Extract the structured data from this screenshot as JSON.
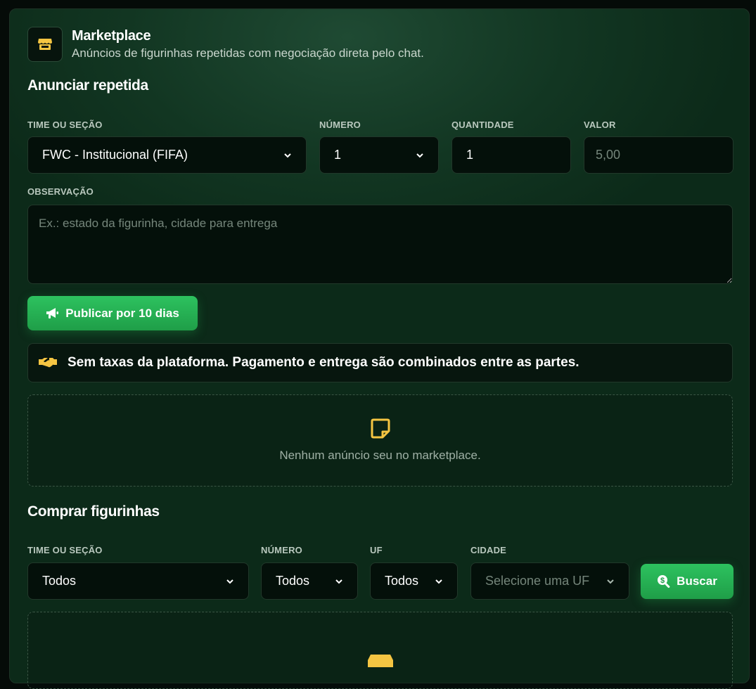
{
  "header": {
    "title": "Marketplace",
    "subtitle": "Anúncios de figurinhas repetidas com negociação direta pelo chat.",
    "icon": "store-icon"
  },
  "announce": {
    "section_title": "Anunciar repetida",
    "team_label": "TIME OU SEÇÃO",
    "team_value": "FWC - Institucional (FIFA)",
    "number_label": "NÚMERO",
    "number_value": "1",
    "quantity_label": "QUANTIDADE",
    "quantity_value": "1",
    "price_label": "VALOR",
    "price_placeholder": "5,00",
    "note_label": "OBSERVAÇÃO",
    "note_placeholder": "Ex.: estado da figurinha, cidade para entrega",
    "publish_label": "Publicar por 10 dias",
    "info_text": "Sem taxas da plataforma. Pagamento e entrega são combinados entre as partes.",
    "empty_text": "Nenhum anúncio seu no marketplace."
  },
  "buy": {
    "section_title": "Comprar figurinhas",
    "team_label": "TIME OU SEÇÃO",
    "team_value": "Todos",
    "number_label": "NÚMERO",
    "number_value": "Todos",
    "uf_label": "UF",
    "uf_value": "Todos",
    "city_label": "CIDADE",
    "city_value": "Selecione uma UF",
    "search_label": "Buscar"
  },
  "colors": {
    "accent_green": "#22a34c",
    "icon_yellow": "#f5c542"
  }
}
